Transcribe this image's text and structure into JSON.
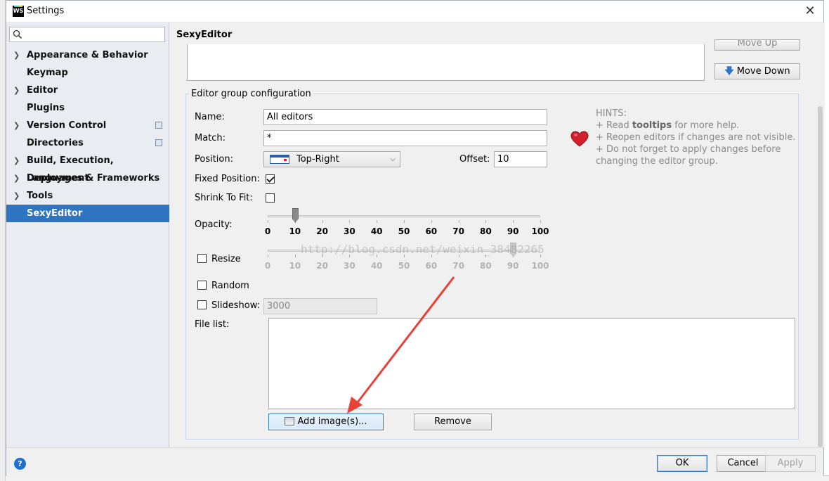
{
  "window": {
    "title": "Settings",
    "logo_text": "WS"
  },
  "sidebar": {
    "search_placeholder": "",
    "items": [
      {
        "label": "Appearance & Behavior",
        "expandable": true,
        "badge": false
      },
      {
        "label": "Keymap",
        "expandable": false,
        "badge": false
      },
      {
        "label": "Editor",
        "expandable": true,
        "badge": false
      },
      {
        "label": "Plugins",
        "expandable": false,
        "badge": false
      },
      {
        "label": "Version Control",
        "expandable": true,
        "badge": true
      },
      {
        "label": "Directories",
        "expandable": false,
        "badge": true
      },
      {
        "label": "Build, Execution, Deployment",
        "expandable": true,
        "badge": false
      },
      {
        "label": "Languages & Frameworks",
        "expandable": true,
        "badge": false
      },
      {
        "label": "Tools",
        "expandable": true,
        "badge": false
      },
      {
        "label": "SexyEditor",
        "expandable": false,
        "badge": false,
        "selected": true
      }
    ]
  },
  "main": {
    "title": "SexyEditor",
    "move_up_label": "Move Up",
    "move_down_label": "Move Down",
    "group": {
      "legend": "Editor group configuration",
      "name_label": "Name:",
      "name_value": "All editors",
      "match_label": "Match:",
      "match_value": "*",
      "position_label": "Position:",
      "position_value": "Top-Right",
      "offset_label": "Offset:",
      "offset_value": "10",
      "fixed_position_label": "Fixed Position:",
      "fixed_position_checked": true,
      "shrink_label": "Shrink To Fit:",
      "shrink_checked": false,
      "opacity_label": "Opacity:",
      "opacity_value": 10,
      "opacity_ticks": [
        "0",
        "10",
        "20",
        "30",
        "40",
        "50",
        "60",
        "70",
        "80",
        "90",
        "100"
      ],
      "resize_label": "Resize",
      "resize_checked": false,
      "resize_value": 90,
      "resize_ticks": [
        "0",
        "10",
        "20",
        "30",
        "40",
        "50",
        "60",
        "70",
        "80",
        "90",
        "100"
      ],
      "random_label": "Random",
      "random_checked": false,
      "slideshow_label": "Slideshow:",
      "slideshow_checked": false,
      "slideshow_value": "3000",
      "file_list_label": "File list:",
      "add_images_label": "Add image(s)...",
      "remove_label": "Remove"
    },
    "hints": {
      "title": "HINTS:",
      "line1_prefix": "+ Read ",
      "line1_bold": "tooltips",
      "line1_suffix": " for more help.",
      "line2": "+ Reopen editors if changes are not visible.",
      "line3": "+ Do not forget to apply changes before",
      "line4": "changing the editor group."
    },
    "watermark": "http://blog.csdn.net/weixin_38482265"
  },
  "footer": {
    "help_label": "?",
    "ok_label": "OK",
    "cancel_label": "Cancel",
    "apply_label": "Apply"
  },
  "colors": {
    "selected_bg": "#2f74c0",
    "annotation_arrow": "#e8403a",
    "heart": "#d3202a"
  }
}
